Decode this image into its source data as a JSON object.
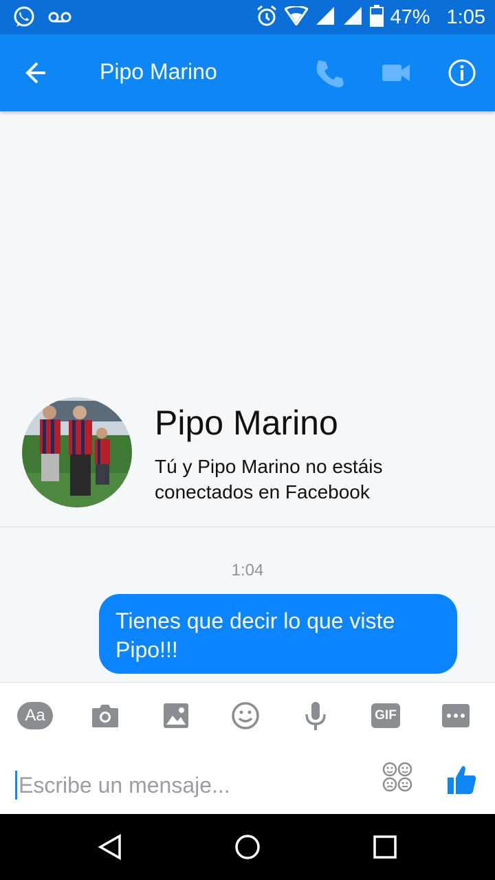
{
  "status_bar": {
    "battery_percent": "47%",
    "time": "1:05",
    "icons": [
      "whatsapp-icon",
      "voicemail-icon",
      "alarm-icon",
      "wifi-icon",
      "signal-icon",
      "signal-icon",
      "battery-icon"
    ]
  },
  "app_bar": {
    "title": "Pipo Marino",
    "back_icon": "arrow-left-icon",
    "actions": [
      "phone-icon",
      "video-camera-icon",
      "info-icon"
    ]
  },
  "profile": {
    "name": "Pipo Marino",
    "subtitle": "Tú y Pipo Marino no estáis conectados en Facebook"
  },
  "conversation": {
    "timestamp": "1:04",
    "messages": [
      {
        "sender": "me",
        "text": "Tienes que decir lo que viste Pipo!!!"
      }
    ]
  },
  "composer": {
    "aa_label": "Aa",
    "gif_label": "GIF",
    "placeholder": "Escribe un mensaje...",
    "tools": [
      "aa-icon",
      "camera-icon",
      "image-icon",
      "emoji-icon",
      "microphone-icon",
      "gif-icon",
      "more-icon"
    ]
  },
  "colors": {
    "app_bar": "#0d87f5",
    "status_bar": "#0a6fd8",
    "bubble": "#0a84ff",
    "tool_gray": "#8a8d91"
  }
}
